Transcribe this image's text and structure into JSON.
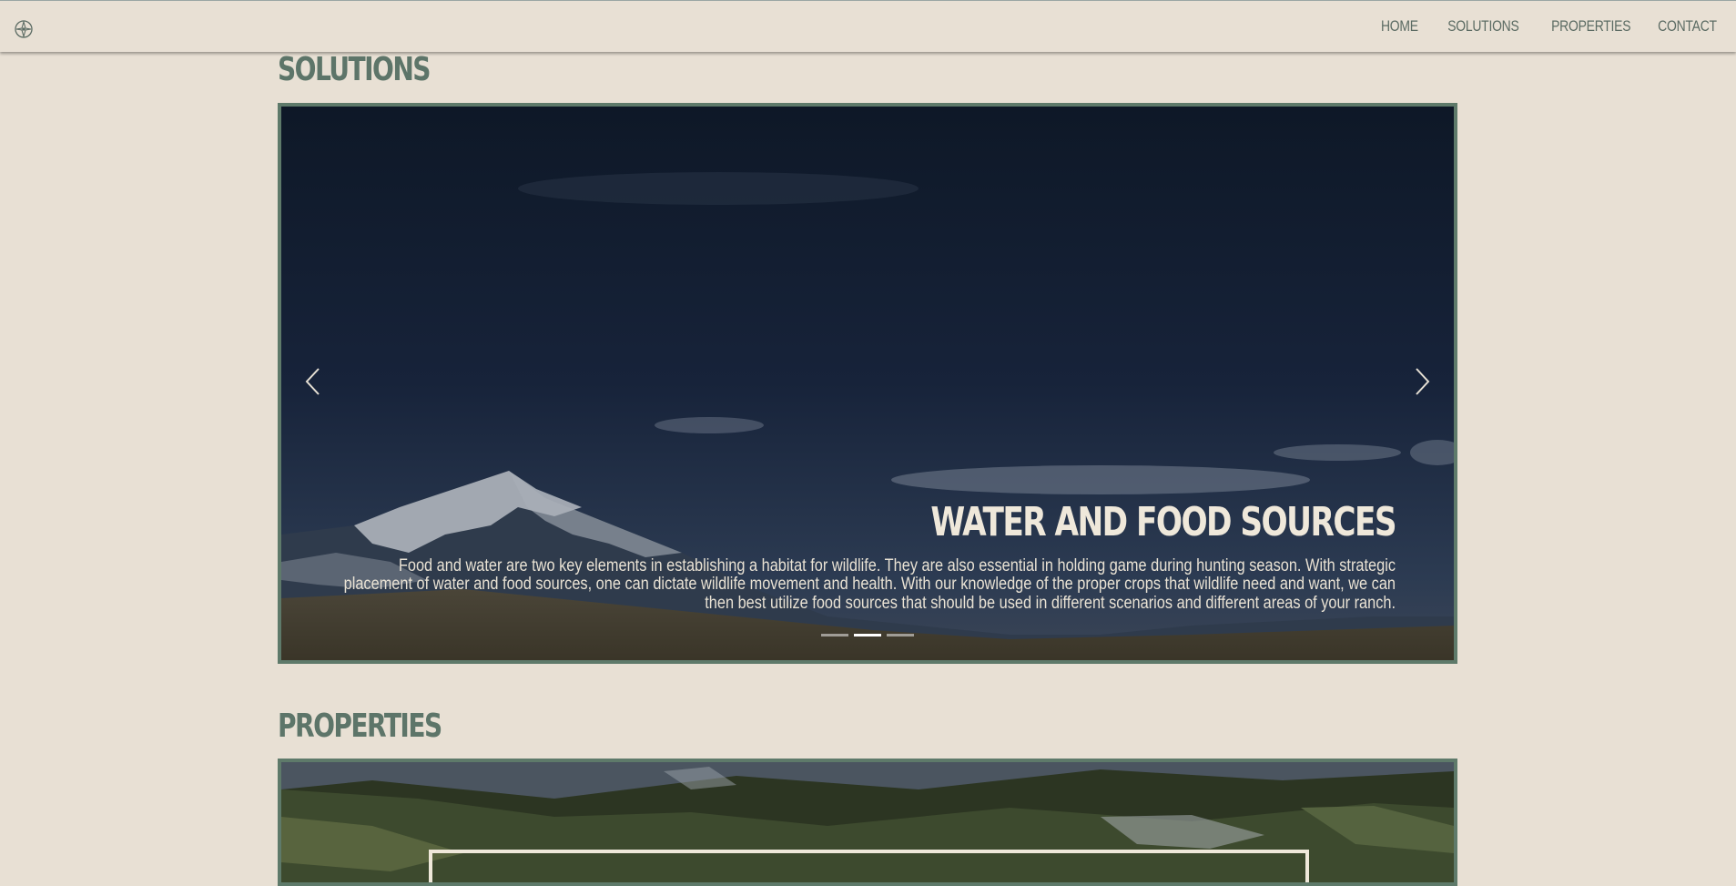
{
  "nav": {
    "logo_icon": "compass-icon",
    "links": [
      "HOME",
      "SOLUTIONS",
      "PROPERTIES",
      "CONTACT"
    ]
  },
  "solutions": {
    "title": "SOLUTIONS",
    "slide": {
      "title": "WATER AND FOOD SOURCES",
      "text": "Food and water are two key elements in establishing a habitat for wildlife. They are also essential in holding game during hunting season. With strategic placement of water and food sources, one can dictate wildlife movement and health. With our knowledge of the proper crops that wildlife need and want, we can then best utilize food sources that should be used in different scenarios and different areas of your ranch."
    },
    "slide_count": 3,
    "active_slide": 2,
    "prev_icon": "chevron-left-icon",
    "next_icon": "chevron-right-icon"
  },
  "properties": {
    "title": "PROPERTIES"
  },
  "colors": {
    "page_bg": "#e8e0d4",
    "accent_green": "#5d7569",
    "frame_green": "#5e7a6a",
    "nav_text": "#5b6b63"
  }
}
